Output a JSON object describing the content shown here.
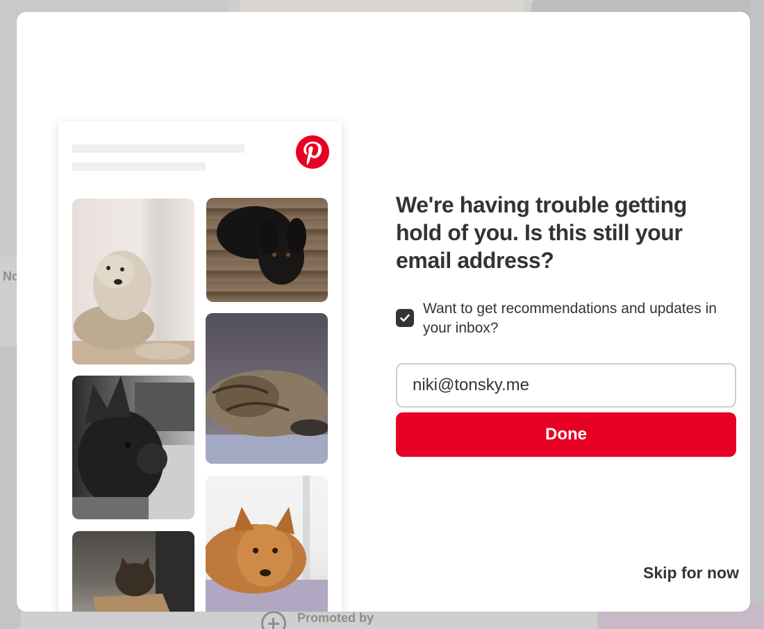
{
  "background": {
    "fragment_text": "No",
    "promoted_text": "Promoted by"
  },
  "modal": {
    "heading": "We're having trouble getting hold of you. Is this still your email address?",
    "checkbox": {
      "checked": true,
      "label": "Want to get recommendations and updates in your inbox?"
    },
    "email_input": {
      "value": "niki@tonsky.me"
    },
    "done_label": "Done",
    "skip_label": "Skip for now"
  },
  "illustration": {
    "logo_icon": "pinterest-logo-icon",
    "pins": [
      {
        "subject": "wheaten-terrier-photo"
      },
      {
        "subject": "black-labrador-photo"
      },
      {
        "subject": "sleeping-cat-photo"
      },
      {
        "subject": "french-bulldog-photo"
      },
      {
        "subject": "orange-dog-photo"
      },
      {
        "subject": "cat-in-box-photo"
      }
    ]
  },
  "colors": {
    "brand_red": "#e60023",
    "text_dark": "#333333"
  }
}
